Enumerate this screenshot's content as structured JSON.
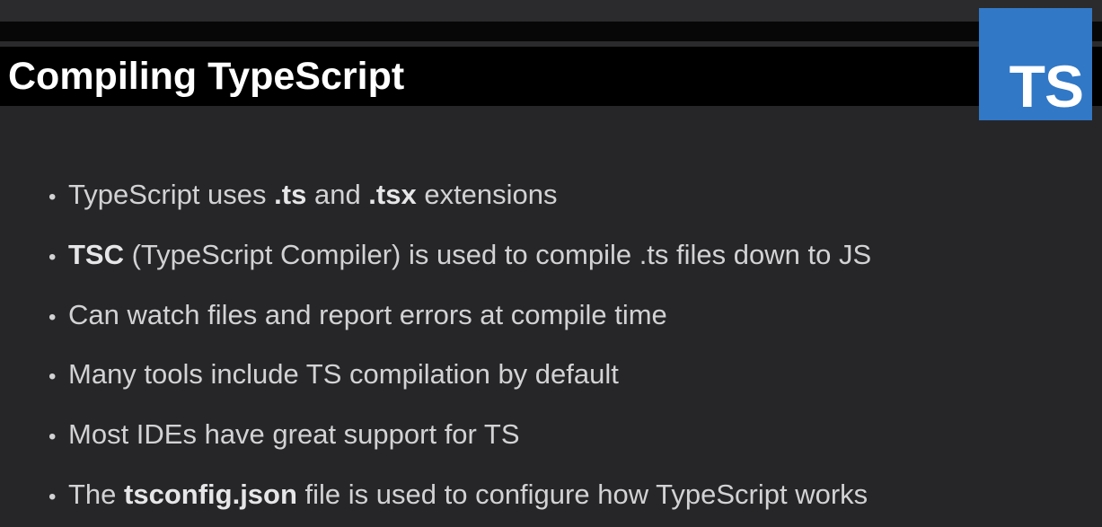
{
  "slide": {
    "title": "Compiling TypeScript",
    "logo_text": "TS",
    "bullet_marker": "•"
  },
  "bullets": [
    {
      "parts": [
        "TypeScript uses ",
        ".ts",
        " and ",
        ".tsx",
        " extensions"
      ]
    },
    {
      "parts": [
        "TSC",
        " (TypeScript Compiler) is used to compile .ts files down to JS"
      ]
    },
    {
      "parts": [
        "Can watch files and report errors at compile time"
      ]
    },
    {
      "parts": [
        "Many tools include TS compilation by default"
      ]
    },
    {
      "parts": [
        "Most IDEs have great support for TS"
      ]
    },
    {
      "parts": [
        "The ",
        "tsconfig.json",
        " file is used to configure how TypeScript works"
      ]
    }
  ],
  "colors": {
    "background": "#262628",
    "title_bar": "#000000",
    "logo_background": "#3178c6",
    "text": "#d2d2d4",
    "title_text": "#ffffff"
  },
  "icons": {
    "logo": "typescript-logo-icon"
  }
}
